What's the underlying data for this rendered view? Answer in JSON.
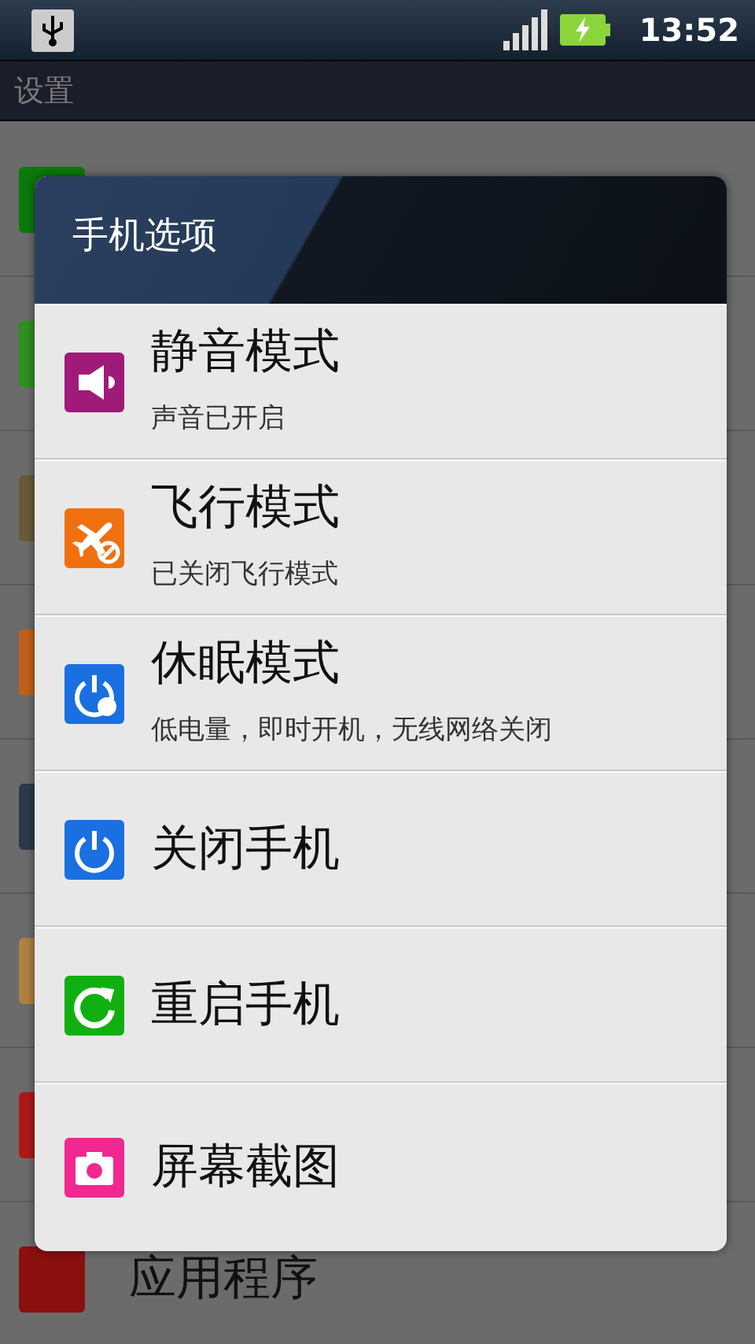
{
  "status_bar": {
    "time": "13:52"
  },
  "title_bar": {
    "title": "设置"
  },
  "settings_rows": [
    {
      "color": "#0b7a0b"
    },
    {
      "color": "#2f8f1f"
    },
    {
      "color": "#6a5a3a"
    },
    {
      "color": "#c0601a"
    },
    {
      "color": "#2a3a4a"
    },
    {
      "color": "#b08040"
    },
    {
      "color": "#b01818"
    },
    {
      "color": "#8a1010",
      "label": "应用程序"
    }
  ],
  "dialog": {
    "title": "手机选项",
    "options": [
      {
        "kind": "sound",
        "title": "静音模式",
        "subtitle": "声音已开启"
      },
      {
        "kind": "airplane",
        "title": "飞行模式",
        "subtitle": "已关闭飞行模式"
      },
      {
        "kind": "sleep",
        "title": "休眠模式",
        "subtitle": "低电量，即时开机，无线网络关闭"
      },
      {
        "kind": "power",
        "title": "关闭手机"
      },
      {
        "kind": "restart",
        "title": "重启手机"
      },
      {
        "kind": "screenshot",
        "title": "屏幕截图"
      }
    ]
  }
}
